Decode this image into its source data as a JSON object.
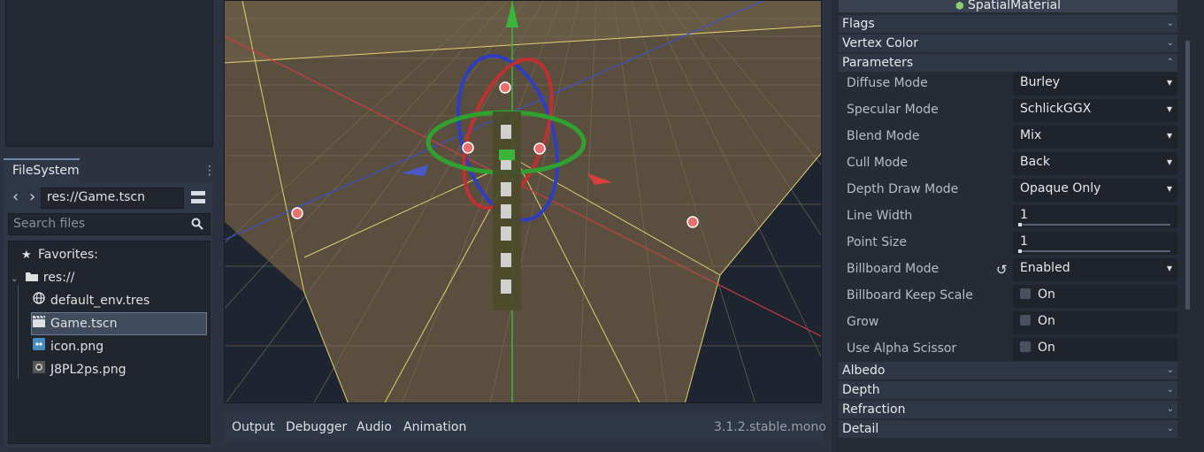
{
  "filesystem": {
    "tab_label": "FileSystem",
    "path": "res://Game.tscn",
    "search_placeholder": "Search files",
    "favorites_label": "Favorites:",
    "root_label": "res://",
    "files": [
      {
        "name": "default_env.tres",
        "icon": "globe-icon"
      },
      {
        "name": "Game.tscn",
        "icon": "clapperboard-icon",
        "selected": true
      },
      {
        "name": "icon.png",
        "icon": "image-icon"
      },
      {
        "name": "J8PL2ps.png",
        "icon": "image-icon"
      }
    ]
  },
  "bottom_panel": {
    "tabs": [
      "Output",
      "Debugger",
      "Audio",
      "Animation"
    ],
    "version": "3.1.2.stable.mono"
  },
  "inspector": {
    "title": "SpatialMaterial",
    "sections_top": [
      "Flags",
      "Vertex Color",
      "Parameters"
    ],
    "properties": [
      {
        "label": "Diffuse Mode",
        "value": "Burley",
        "kind": "dropdown"
      },
      {
        "label": "Specular Mode",
        "value": "SchlickGGX",
        "kind": "dropdown"
      },
      {
        "label": "Blend Mode",
        "value": "Mix",
        "kind": "dropdown"
      },
      {
        "label": "Cull Mode",
        "value": "Back",
        "kind": "dropdown"
      },
      {
        "label": "Depth Draw Mode",
        "value": "Opaque Only",
        "kind": "dropdown"
      },
      {
        "label": "Line Width",
        "value": "1",
        "kind": "slider"
      },
      {
        "label": "Point Size",
        "value": "1",
        "kind": "slider"
      },
      {
        "label": "Billboard Mode",
        "value": "Enabled",
        "kind": "dropdown"
      },
      {
        "label": "Billboard Keep Scale",
        "value": "On",
        "kind": "checkbox"
      },
      {
        "label": "Grow",
        "value": "On",
        "kind": "checkbox"
      },
      {
        "label": "Use Alpha Scissor",
        "value": "On",
        "kind": "checkbox"
      }
    ],
    "sections_bottom": [
      "Albedo",
      "Depth",
      "Refraction",
      "Detail"
    ]
  },
  "colors": {
    "accent": "#6e87ad",
    "gizmo_red": "#d23c3c",
    "gizmo_green": "#3cb43c",
    "gizmo_blue": "#3c50c8",
    "handle": "#e87070"
  }
}
